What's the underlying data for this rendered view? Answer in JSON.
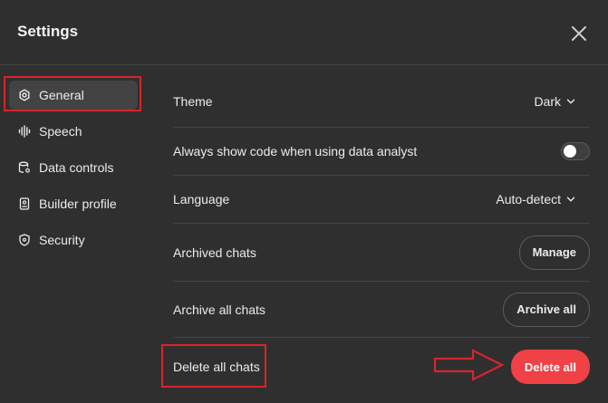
{
  "header": {
    "title": "Settings"
  },
  "sidebar": {
    "items": [
      {
        "label": "General",
        "icon": "gear-icon",
        "active": true
      },
      {
        "label": "Speech",
        "icon": "waveform-icon",
        "active": false
      },
      {
        "label": "Data controls",
        "icon": "database-icon",
        "active": false
      },
      {
        "label": "Builder profile",
        "icon": "id-badge-icon",
        "active": false
      },
      {
        "label": "Security",
        "icon": "shield-icon",
        "active": false
      }
    ]
  },
  "general": {
    "theme": {
      "label": "Theme",
      "value": "Dark"
    },
    "code_toggle": {
      "label": "Always show code when using data analyst",
      "enabled": false
    },
    "language": {
      "label": "Language",
      "value": "Auto-detect"
    },
    "archived_chats": {
      "label": "Archived chats",
      "button": "Manage"
    },
    "archive_all": {
      "label": "Archive all chats",
      "button": "Archive all"
    },
    "delete_all": {
      "label": "Delete all chats",
      "button": "Delete all"
    }
  },
  "colors": {
    "background": "#2f2f2f",
    "danger": "#ef4146",
    "annotation": "#d8242b"
  }
}
